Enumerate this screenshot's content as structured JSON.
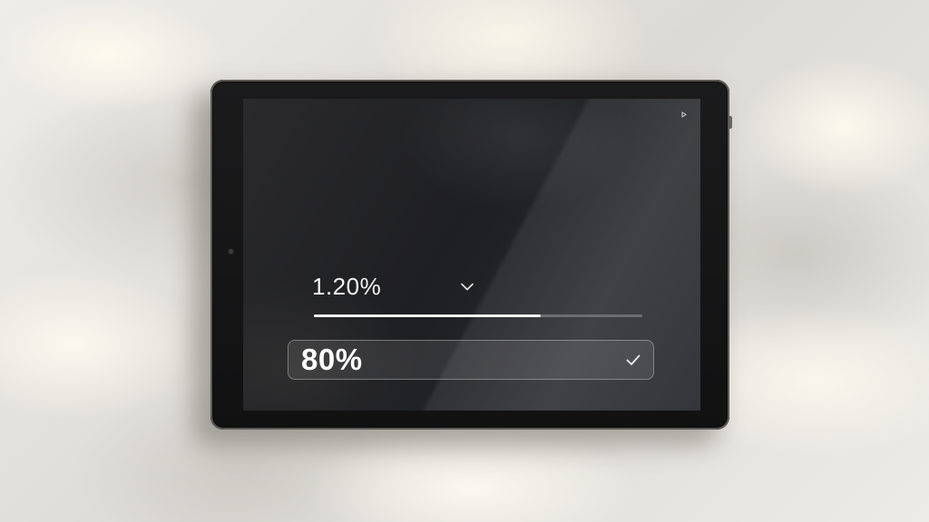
{
  "screen": {
    "status_icon": "small-indicator-icon",
    "primary_value": "1.20%",
    "primary_check_icon": "check-icon",
    "progress": {
      "fraction": 0.69
    },
    "secondary_value": "80%",
    "secondary_check_icon": "check-icon"
  },
  "colors": {
    "text": "#f4f4f4",
    "progress_fill": "#f2f2f2",
    "progress_track": "#6c6d70"
  }
}
